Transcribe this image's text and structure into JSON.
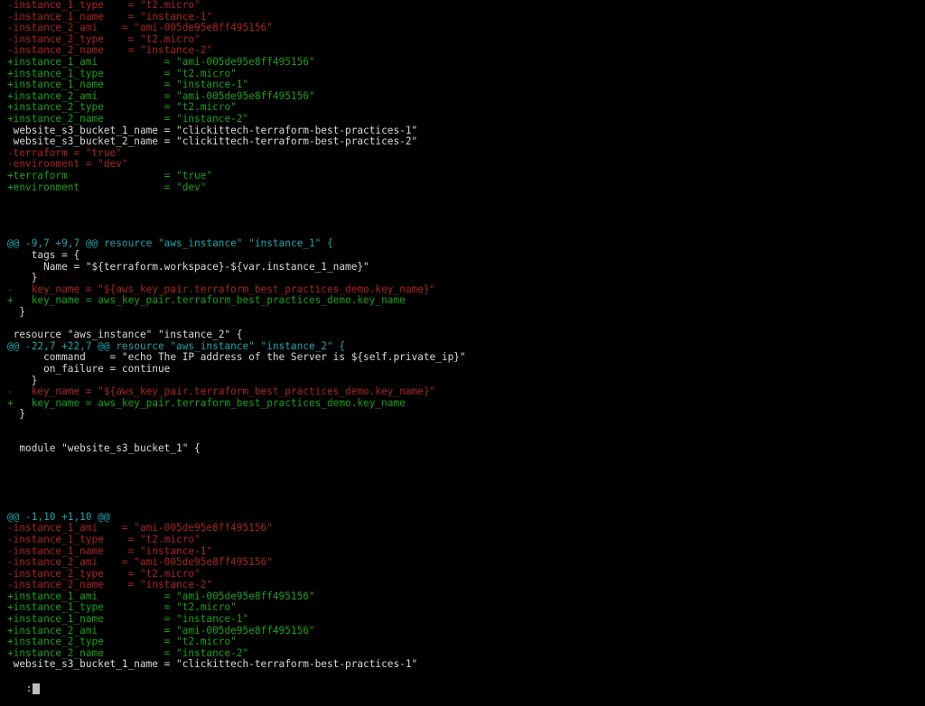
{
  "terminal": {
    "window_title": "terminal-diff-viewer",
    "background_color": "#000000",
    "colors": {
      "deletion": "#aa2222",
      "addition": "#19a019",
      "context": "#d8d8d8",
      "hunk_header": "#1ba5ad",
      "cursor": "#bdbdbd"
    },
    "pager_prompt": ":",
    "lines": [
      {
        "type": "del",
        "text": "-instance_1_type    = \"t2.micro\""
      },
      {
        "type": "del",
        "text": "-instance_1_name    = \"instance-1\""
      },
      {
        "type": "del",
        "text": "-instance_2_ami    = \"ami-005de95e8ff495156\""
      },
      {
        "type": "del",
        "text": "-instance_2_type    = \"t2.micro\""
      },
      {
        "type": "del",
        "text": "-instance_2_name    = \"instance-2\""
      },
      {
        "type": "add",
        "text": "+instance_1_ami           = \"ami-005de95e8ff495156\""
      },
      {
        "type": "add",
        "text": "+instance_1_type          = \"t2.micro\""
      },
      {
        "type": "add",
        "text": "+instance_1_name          = \"instance-1\""
      },
      {
        "type": "add",
        "text": "+instance_2_ami           = \"ami-005de95e8ff495156\""
      },
      {
        "type": "add",
        "text": "+instance_2_type          = \"t2.micro\""
      },
      {
        "type": "add",
        "text": "+instance_2_name          = \"instance-2\""
      },
      {
        "type": "ctx",
        "text": " website_s3_bucket_1_name = \"clickittech-terraform-best-practices-1\""
      },
      {
        "type": "ctx",
        "text": " website_s3_bucket_2_name = \"clickittech-terraform-best-practices-2\""
      },
      {
        "type": "del",
        "text": "-terraform = \"true\""
      },
      {
        "type": "del",
        "text": "-environment = \"dev\""
      },
      {
        "type": "add",
        "text": "+terraform                = \"true\""
      },
      {
        "type": "add",
        "text": "+environment              = \"dev\""
      },
      {
        "type": "blank",
        "text": ""
      },
      {
        "type": "blank",
        "text": ""
      },
      {
        "type": "blank",
        "text": ""
      },
      {
        "type": "blank",
        "text": ""
      },
      {
        "type": "hunk",
        "text": "@@ -9,7 +9,7 @@ resource \"aws_instance\" \"instance_1\" {"
      },
      {
        "type": "ctx",
        "text": "    tags = {"
      },
      {
        "type": "ctx",
        "text": "      Name = \"${terraform.workspace}-${var.instance_1_name}\""
      },
      {
        "type": "ctx",
        "text": "    }"
      },
      {
        "type": "del",
        "text": "-   key_name = \"${aws_key_pair.terraform_best_practices_demo.key_name}\""
      },
      {
        "type": "add",
        "text": "+   key_name = aws_key_pair.terraform_best_practices_demo.key_name"
      },
      {
        "type": "ctx",
        "text": "  }"
      },
      {
        "type": "blank",
        "text": ""
      },
      {
        "type": "ctx",
        "text": " resource \"aws_instance\" \"instance_2\" {"
      },
      {
        "type": "hunk",
        "text": "@@ -22,7 +22,7 @@ resource \"aws_instance\" \"instance_2\" {"
      },
      {
        "type": "ctx",
        "text": "      command    = \"echo The IP address of the Server is ${self.private_ip}\""
      },
      {
        "type": "ctx",
        "text": "      on_failure = continue"
      },
      {
        "type": "ctx",
        "text": "    }"
      },
      {
        "type": "del",
        "text": "-   key_name = \"${aws_key_pair.terraform_best_practices_demo.key_name}\""
      },
      {
        "type": "add",
        "text": "+   key_name = aws_key_pair.terraform_best_practices_demo.key_name"
      },
      {
        "type": "ctx",
        "text": "  }"
      },
      {
        "type": "blank",
        "text": ""
      },
      {
        "type": "blank",
        "text": ""
      },
      {
        "type": "ctx",
        "text": "  module \"website_s3_bucket_1\" {"
      },
      {
        "type": "blank",
        "text": ""
      },
      {
        "type": "blank",
        "text": ""
      },
      {
        "type": "blank",
        "text": ""
      },
      {
        "type": "blank",
        "text": ""
      },
      {
        "type": "blank",
        "text": ""
      },
      {
        "type": "hunk",
        "text": "@@ -1,10 +1,10 @@"
      },
      {
        "type": "del",
        "text": "-instance_1_ami    = \"ami-005de95e8ff495156\""
      },
      {
        "type": "del",
        "text": "-instance_1_type    = \"t2.micro\""
      },
      {
        "type": "del",
        "text": "-instance_1_name    = \"instance-1\""
      },
      {
        "type": "del",
        "text": "-instance_2_ami    = \"ami-005de95e8ff495156\""
      },
      {
        "type": "del",
        "text": "-instance_2_type    = \"t2.micro\""
      },
      {
        "type": "del",
        "text": "-instance_2_name    = \"instance-2\""
      },
      {
        "type": "add",
        "text": "+instance_1_ami           = \"ami-005de95e8ff495156\""
      },
      {
        "type": "add",
        "text": "+instance_1_type          = \"t2.micro\""
      },
      {
        "type": "add",
        "text": "+instance_1_name          = \"instance-1\""
      },
      {
        "type": "add",
        "text": "+instance_2_ami           = \"ami-005de95e8ff495156\""
      },
      {
        "type": "add",
        "text": "+instance_2_type          = \"t2.micro\""
      },
      {
        "type": "add",
        "text": "+instance_2_name          = \"instance-2\""
      },
      {
        "type": "ctx",
        "text": " website_s3_bucket_1_name = \"clickittech-terraform-best-practices-1\""
      }
    ]
  }
}
